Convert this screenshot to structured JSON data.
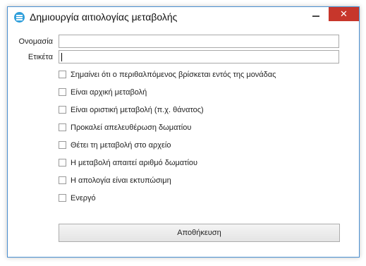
{
  "window": {
    "title": "Δημιουργία αιτιολογίας μεταβολής",
    "close_glyph": "✕",
    "accent_color": "#c7362b"
  },
  "form": {
    "name_label": "Ονομασία",
    "name_value": "",
    "tag_label": "Ετικέτα",
    "tag_value": ""
  },
  "checkboxes": [
    {
      "label": "Σημαίνει ότι ο περιθαλπόμενος βρίσκεται εντός της μονάδας",
      "checked": false
    },
    {
      "label": "Είναι αρχική μεταβολή",
      "checked": false
    },
    {
      "label": "Είναι οριστική μεταβολή (π.χ. θάνατος)",
      "checked": false
    },
    {
      "label": "Προκαλεί απελευθέρωση δωματίου",
      "checked": false
    },
    {
      "label": "Θέτει τη μεταβολή στο αρχείο",
      "checked": false
    },
    {
      "label": "Η μεταβολή απαιτεί αριθμό δωματίου",
      "checked": false
    },
    {
      "label": "Η απολογία είναι εκτυπώσιμη",
      "checked": false
    },
    {
      "label": "Ενεργό",
      "checked": false
    }
  ],
  "actions": {
    "save_label": "Αποθήκευση"
  }
}
